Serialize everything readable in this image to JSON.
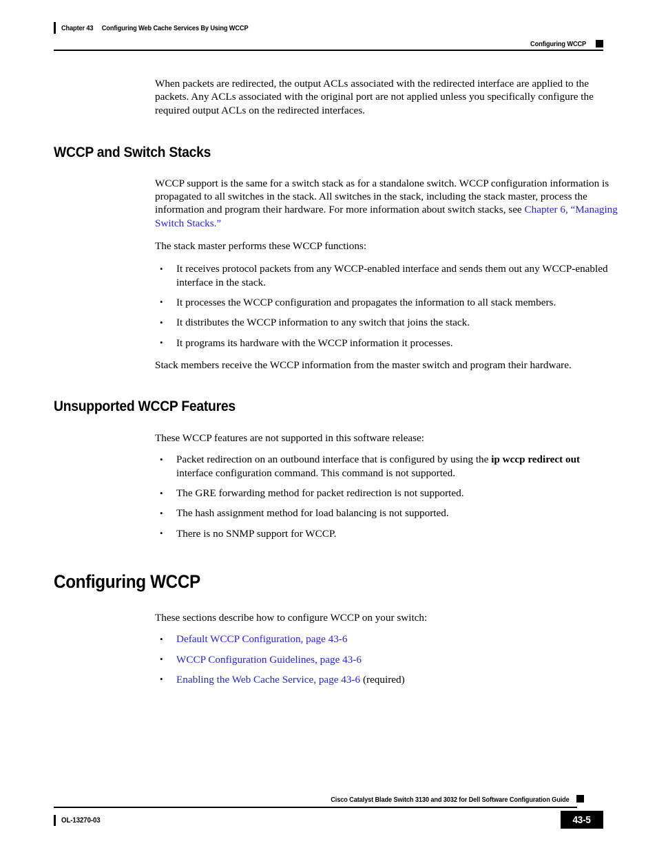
{
  "header": {
    "chapter_number": "Chapter 43",
    "chapter_title": "Configuring Web Cache Services By Using WCCP",
    "section_title": "Configuring WCCP"
  },
  "body": {
    "intro_paragraph": "When packets are redirected, the output ACLs associated with the redirected interface are applied to the packets. Any ACLs associated with the original port are not applied unless you specifically configure the required output ACLs on the redirected interfaces.",
    "section_wccp_stacks": {
      "heading": "WCCP and Switch Stacks",
      "paragraph_1_pre": "WCCP support is the same for a switch stack as for a standalone switch. WCCP configuration information is propagated to all switches in the stack. All switches in the stack, including the stack master, process the information and program their hardware. For more information about switch stacks, see ",
      "paragraph_1_link": "Chapter 6, “Managing Switch Stacks.”",
      "paragraph_2": "The stack master performs these WCCP functions:",
      "bullets": [
        "It receives protocol packets from any WCCP-enabled interface and sends them out any WCCP-enabled interface in the stack.",
        "It processes the WCCP configuration and propagates the information to all stack members.",
        "It distributes the WCCP information to any switch that joins the stack.",
        "It programs its hardware with the WCCP information it processes."
      ],
      "paragraph_3": "Stack members receive the WCCP information from the master switch and program their hardware."
    },
    "section_unsupported": {
      "heading": "Unsupported WCCP Features",
      "paragraph_1": "These WCCP features are not supported in this software release:",
      "bullet_1_pre": "Packet redirection on an outbound interface that is configured by using the ",
      "bullet_1_command": "ip wccp redirect out",
      "bullet_1_post": " interface configuration command. This command is not supported.",
      "bullets_rest": [
        "The GRE forwarding method for packet redirection is not supported.",
        "The hash assignment method for load balancing is not supported.",
        "There is no SNMP support for WCCP."
      ]
    },
    "section_configuring": {
      "heading": "Configuring WCCP",
      "paragraph_1": "These sections describe how to configure WCCP on your switch:",
      "links": [
        {
          "text": "Default WCCP Configuration, page 43-6",
          "suffix": ""
        },
        {
          "text": "WCCP Configuration Guidelines, page 43-6",
          "suffix": ""
        },
        {
          "text": "Enabling the Web Cache Service, page 43-6",
          "suffix": " (required)"
        }
      ]
    }
  },
  "footer": {
    "guide_title": "Cisco Catalyst Blade Switch 3130 and 3032 for Dell Software Configuration Guide",
    "document_id": "OL-13270-03",
    "page_number": "43-5"
  },
  "colors": {
    "link": "#2222e8",
    "text": "#000000",
    "rule": "#000000"
  }
}
